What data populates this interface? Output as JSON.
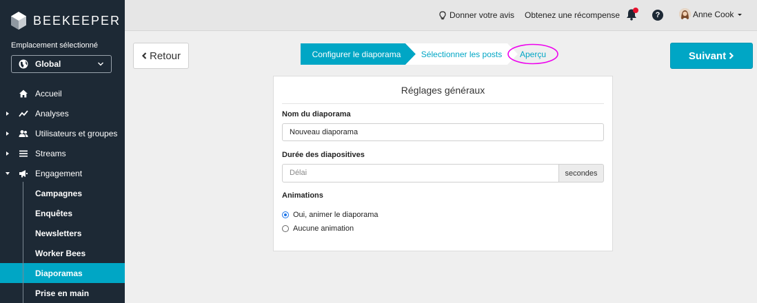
{
  "sidebar": {
    "logo_text": "BEEKEEPER",
    "location_label": "Emplacement sélectionné",
    "location_value": "Global",
    "nav": [
      {
        "label": "Accueil",
        "icon": "home-icon"
      },
      {
        "label": "Analyses",
        "icon": "chart-line-icon"
      },
      {
        "label": "Utilisateurs et groupes",
        "icon": "users-icon"
      },
      {
        "label": "Streams",
        "icon": "list-icon"
      },
      {
        "label": "Engagement",
        "icon": "megaphone-icon"
      }
    ],
    "subnav": [
      {
        "label": "Campagnes"
      },
      {
        "label": "Enquêtes"
      },
      {
        "label": "Newsletters"
      },
      {
        "label": "Worker Bees"
      },
      {
        "label": "Diaporamas"
      },
      {
        "label": "Prise en main"
      }
    ],
    "active_sub": "Diaporamas"
  },
  "topbar": {
    "feedback": "Donner votre avis",
    "reward": "Obtenez une récompense",
    "user_name": "Anne Cook"
  },
  "actions": {
    "back": "Retour",
    "next": "Suivant"
  },
  "wizard": {
    "steps": [
      "Configurer le diaporama",
      "Sélectionner les posts",
      "Aperçu"
    ]
  },
  "card": {
    "title": "Réglages généraux",
    "name_label": "Nom du diaporama",
    "name_value": "Nouveau diaporama",
    "duration_label": "Durée des diapositives",
    "duration_placeholder": "Délai",
    "duration_unit": "secondes",
    "animations_label": "Animations",
    "option_animate": "Oui, animer le diaporama",
    "option_none": "Aucune animation"
  },
  "colors": {
    "accent": "#00a6c5",
    "sidebar": "#1d2935",
    "highlight_circle": "#ee00ee"
  }
}
